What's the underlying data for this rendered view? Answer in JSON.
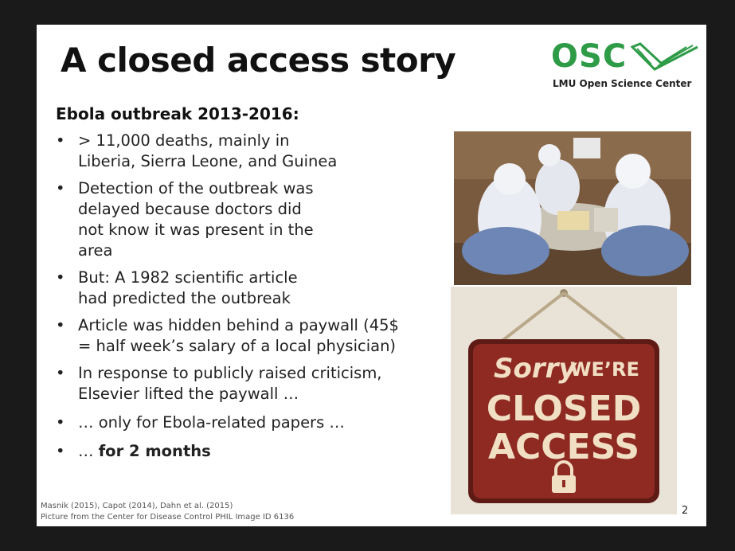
{
  "slide": {
    "title": "A closed access story",
    "logo": {
      "mark": "OSC",
      "subtitle": "LMU Open Science Center"
    },
    "heading": "Ebola outbreak 2013-2016:",
    "bullets": [
      {
        "lines": [
          "> 11,000 deaths, mainly in",
          "Liberia, Sierra Leone, and Guinea"
        ]
      },
      {
        "lines": [
          "Detection of the outbreak was",
          "delayed because doctors did",
          "not know it was present in the",
          "area"
        ]
      },
      {
        "lines": [
          "But: A 1982 scientific article",
          "had predicted the outbreak"
        ]
      },
      {
        "lines": [
          "Article was hidden behind a paywall (45$",
          "= half week’s salary of a local physician)"
        ]
      },
      {
        "lines": [
          "In response to publicly raised criticism,",
          "Elsevier lifted the paywall …"
        ]
      },
      {
        "lines": [
          "… only for Ebola-related papers …"
        ]
      },
      {
        "prefix": "… ",
        "bold": "for 2 months"
      }
    ],
    "sign": {
      "line1_script": "Sorry",
      "line1_rest": "WE’RE",
      "line2": "CLOSED",
      "line3": "ACCESS",
      "icon": "lock-icon"
    },
    "photo": {
      "icon": "ebola-workers-photo"
    },
    "footer": {
      "citations": "Masnik (2015), Capot (2014), Dahn et al. (2015)",
      "credit": "Picture from the Center for Disease Control PHIL Image ID 6136"
    },
    "page_number": "2"
  },
  "colors": {
    "background": "#1a1a1a",
    "slide": "#ffffff",
    "logo_green": "#2e9b47",
    "sign_red": "#8e2a22",
    "sign_cream": "#f1dfc4"
  }
}
